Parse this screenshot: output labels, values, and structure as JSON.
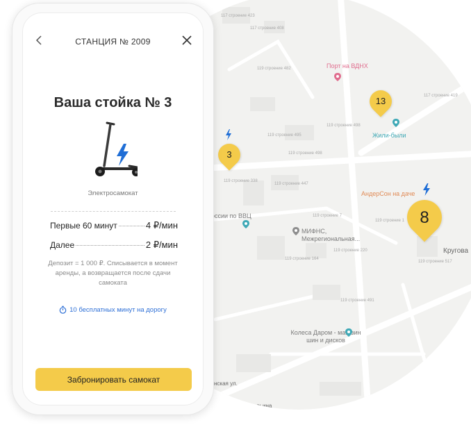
{
  "phone": {
    "nav": {
      "title": "СТАНЦИЯ № 2009"
    },
    "stand_title": "Ваша стойка № 3",
    "vehicle_caption": "Электросамокат",
    "pricing": [
      {
        "label": "Первые 60 минут",
        "price": "4 ₽/мин"
      },
      {
        "label": "Далее",
        "price": "2 ₽/мин"
      }
    ],
    "deposit_note": "Депозит = 1 000 ₽. Списывается в момент аренды, а возвращается после сдачи самоката",
    "free_minutes_link": "10 бесплатных минут на дорогу",
    "book_button": "Забронировать самокат"
  },
  "map": {
    "pins": [
      {
        "count": "3"
      },
      {
        "count": "13"
      },
      {
        "count": "8"
      }
    ],
    "pois": [
      {
        "name": "Порт на ВДНХ"
      },
      {
        "name": "Жили-были"
      },
      {
        "name": "АндерСон на даче"
      },
      {
        "name": "МИФНС, Межрегиональная..."
      },
      {
        "name": "Колеса Даром - магазин шин и дисков"
      },
      {
        "name": "оссии по ВВЦ"
      }
    ],
    "streets": [
      "Кругова",
      "нская ул.",
      "ул. Прасковьина"
    ],
    "building_labels": [
      "117 строение 423",
      "117 строение 408",
      "119 строение 482",
      "119 строение 495",
      "119 строение 498",
      "119 строение 498",
      "119 строение 338",
      "119 строение 447",
      "119 строение 1",
      "119 строение 7",
      "119 строение 220",
      "119 строение 164",
      "119 строение 517",
      "119 строение 491",
      "117 строение 419"
    ],
    "colors": {
      "pin": "#f4cb4a",
      "bolt": "#1f6ed6",
      "poi_pink": "#e06d8e",
      "poi_teal": "#3fa9b6"
    },
    "icons": [
      "bolt-icon",
      "map-pin-icon",
      "poi-icon"
    ]
  }
}
